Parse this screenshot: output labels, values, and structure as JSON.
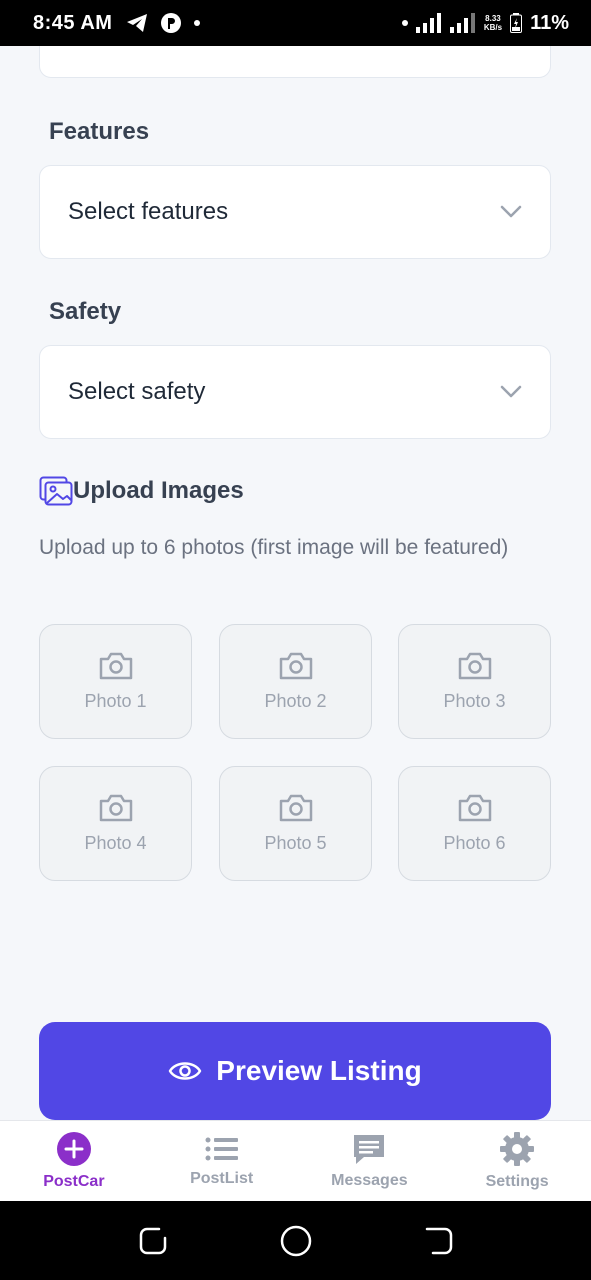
{
  "status_bar": {
    "time": "8:45 AM",
    "speed_value": "8.33",
    "speed_unit": "KB/s",
    "battery": "11%"
  },
  "features": {
    "label": "Features",
    "placeholder": "Select features"
  },
  "safety": {
    "label": "Safety",
    "placeholder": "Select safety"
  },
  "upload": {
    "heading": "Upload Images",
    "hint": "Upload up to 6 photos (first image will be featured)",
    "slots": [
      {
        "label": "Photo 1"
      },
      {
        "label": "Photo 2"
      },
      {
        "label": "Photo 3"
      },
      {
        "label": "Photo 4"
      },
      {
        "label": "Photo 5"
      },
      {
        "label": "Photo 6"
      }
    ]
  },
  "preview_button": {
    "label": "Preview Listing"
  },
  "bottom_nav": {
    "items": [
      {
        "label": "PostCar",
        "icon": "plus-circle-icon",
        "active": true
      },
      {
        "label": "PostList",
        "icon": "list-icon",
        "active": false
      },
      {
        "label": "Messages",
        "icon": "chat-icon",
        "active": false
      },
      {
        "label": "Settings",
        "icon": "gear-icon",
        "active": false
      }
    ]
  },
  "colors": {
    "accent": "#5147e5",
    "active_nav": "#8b2fc9",
    "inactive_nav": "#9ca3af"
  }
}
